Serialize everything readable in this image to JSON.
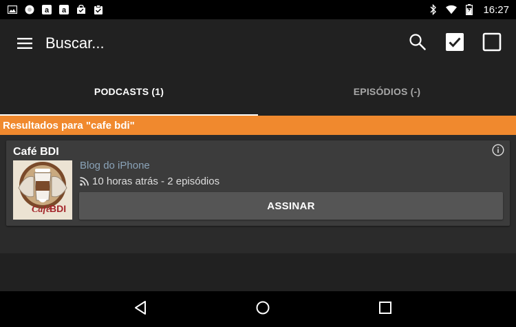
{
  "status_bar": {
    "time": "16:27",
    "left_icons": [
      "image-icon",
      "circle-notification-icon",
      "amazon-icon",
      "amazon-icon",
      "shopping-bag-icon",
      "clipboard-check-icon"
    ],
    "right_icons": [
      "bluetooth-icon",
      "wifi-icon",
      "battery-icon"
    ]
  },
  "toolbar": {
    "title": "Buscar...",
    "menu_icon": "hamburger-menu-icon",
    "actions": [
      "search-icon",
      "checkbox-checked-icon",
      "checkbox-empty-icon"
    ]
  },
  "tabs": [
    {
      "label": "PODCASTS (1)",
      "active": true
    },
    {
      "label": "EPISÓDIOS (-)",
      "active": false
    }
  ],
  "results": {
    "header": "Resultados para \"cafe bdi\""
  },
  "podcast": {
    "title": "Café BDI",
    "author": "Blog do iPhone",
    "meta": "10 horas atrás - 2 episódios",
    "subscribe_label": "ASSINAR",
    "artwork_text": "Café BDI"
  },
  "nav_bar": {
    "buttons": [
      "back-icon",
      "home-icon",
      "recents-icon"
    ]
  },
  "colors": {
    "accent": "#f0892e",
    "toolbar_bg": "#212121",
    "card_bg": "#3c3c3c",
    "author": "#8aa3b8",
    "button_bg": "#555555"
  }
}
